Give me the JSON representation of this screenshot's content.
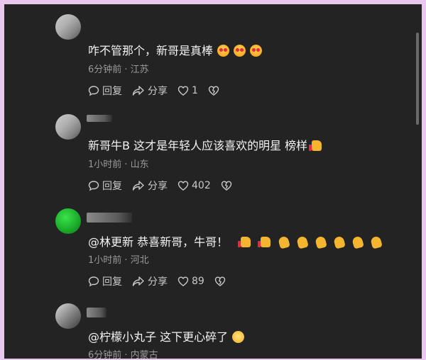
{
  "comments": [
    {
      "text": "咋不管那个，新哥是真棒",
      "time": "6分钟前 · 江苏",
      "reply": "回复",
      "share": "分享",
      "likes": "1",
      "emojis": [
        "heart-eyes",
        "heart-eyes",
        "heart-eyes"
      ]
    },
    {
      "text": "新哥牛B 这才是年轻人应该喜欢的明星 榜样",
      "time": "1小时前 · 山东",
      "reply": "回复",
      "share": "分享",
      "likes": "402",
      "emojis": [
        "thumbs-up"
      ]
    },
    {
      "text": "@林更新  恭喜新哥，牛哥！",
      "time": "1小时前 · 河北",
      "reply": "回复",
      "share": "分享",
      "likes": "89",
      "emojis": [
        "thumbs-up",
        "thumbs-up",
        "clap",
        "clap",
        "clap",
        "clap",
        "clap",
        "clap"
      ]
    },
    {
      "text": "@柠檬小丸子  这下更心碎了",
      "time": "6分钟前 · 内蒙古",
      "emojis": [
        "smile"
      ]
    }
  ]
}
